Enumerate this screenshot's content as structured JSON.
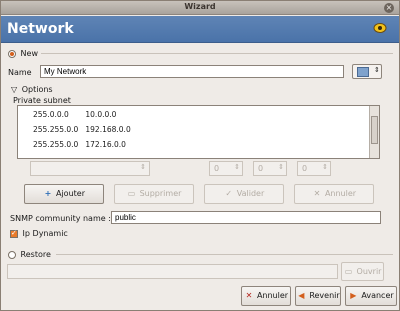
{
  "window": {
    "title": "Wizard"
  },
  "header": {
    "title": "Network"
  },
  "new_option": {
    "label": "New"
  },
  "name": {
    "label": "Name",
    "value": "My Network"
  },
  "options": {
    "label": "Options",
    "private_subnet_label": "Private subnet"
  },
  "subnets": [
    {
      "mask": "255.0.0.0",
      "network": "10.0.0.0"
    },
    {
      "mask": "255.255.0.0",
      "network": "192.168.0.0"
    },
    {
      "mask": "255.255.0.0",
      "network": "172.16.0.0"
    }
  ],
  "ip_fields": [
    "0",
    "0",
    "0"
  ],
  "actions": {
    "add": "Ajouter",
    "delete": "Supprimer",
    "validate": "Valider",
    "cancel_edit": "Annuler"
  },
  "snmp": {
    "label": "SNMP community name :",
    "value": "public"
  },
  "ip_dynamic": {
    "label": "Ip Dynamic",
    "checked": true
  },
  "restore_option": {
    "label": "Restore",
    "open_label": "Ouvrir"
  },
  "footer": {
    "cancel": "Annuler",
    "back": "Revenir",
    "next": "Avancer"
  },
  "colors": {
    "header_blue": "#4a73a9",
    "accent_orange": "#d35f1d"
  }
}
